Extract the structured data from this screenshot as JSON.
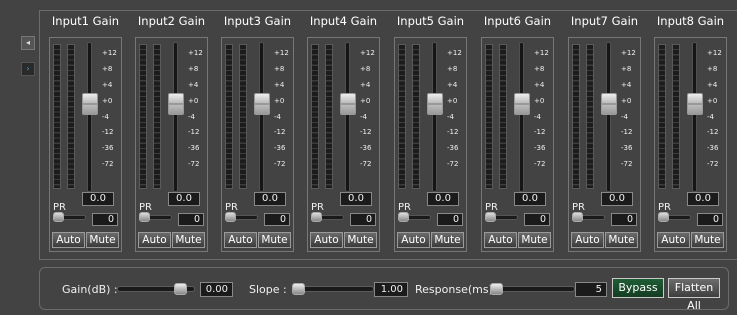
{
  "nav": {
    "prev_icon": "◂",
    "next_icon": "›"
  },
  "scale": [
    "+12",
    "+8",
    "+4",
    "+0",
    "-4",
    "-12",
    "-36",
    "-72"
  ],
  "labels": {
    "pr": "PR",
    "auto": "Auto",
    "mute": "Mute"
  },
  "channels": [
    {
      "title": "Input1 Gain",
      "gain": "0.0",
      "pr": "0"
    },
    {
      "title": "Input2 Gain",
      "gain": "0.0",
      "pr": "0"
    },
    {
      "title": "Input3 Gain",
      "gain": "0.0",
      "pr": "0"
    },
    {
      "title": "Input4 Gain",
      "gain": "0.0",
      "pr": "0"
    },
    {
      "title": "Input5 Gain",
      "gain": "0.0",
      "pr": "0"
    },
    {
      "title": "Input6 Gain",
      "gain": "0.0",
      "pr": "0"
    },
    {
      "title": "Input7 Gain",
      "gain": "0.0",
      "pr": "0"
    },
    {
      "title": "Input8 Gain",
      "gain": "0.0",
      "pr": "0"
    }
  ],
  "bottom": {
    "gain_label": "Gain(dB) :",
    "gain_value": "0.00",
    "slope_label": "Slope :",
    "slope_value": "1.00",
    "response_label": "Response(ms)",
    "response_value": "5",
    "bypass_label": "Bypass",
    "flatten_label": "Flatten All"
  },
  "colors": {
    "background": "#434343",
    "bypass": "#1f5d35",
    "accent_arrow": "#38a8ff"
  }
}
